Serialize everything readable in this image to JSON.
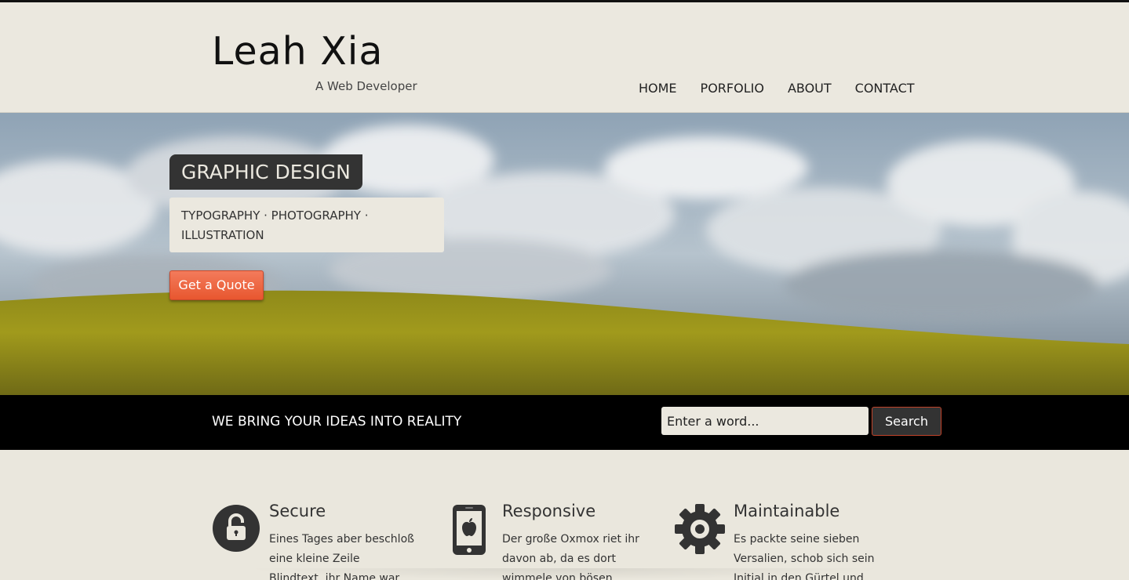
{
  "header": {
    "logo": "Leah Xia",
    "tagline": "A Web Developer",
    "nav": [
      "HOME",
      "PORFOLIO",
      "ABOUT",
      "CONTACT"
    ]
  },
  "hero": {
    "title": "GRAPHIC DESIGN",
    "subtitle_line1": "TYPOGRAPHY · PHOTOGRAPHY ·",
    "subtitle_line2": "ILLUSTRATION",
    "cta": "Get a Quote"
  },
  "bar": {
    "slogan": "WE BRING YOUR IDEAS INTO REALITY",
    "search_placeholder": "Enter a word...",
    "search_button": "Search"
  },
  "features": [
    {
      "title": "Secure",
      "icon": "lock-icon",
      "text": "Eines Tages aber beschloß eine kleine Zeile Blindtext, ihr Name war Lorem"
    },
    {
      "title": "Responsive",
      "icon": "mobile-phone-icon",
      "text": "Der große Oxmox riet ihr davon ab, da es dort wimmele von bösen"
    },
    {
      "title": "Maintainable",
      "icon": "gear-icon",
      "text": "Es packte seine sieben Versalien, schob sich sein Initial in den Gürtel und"
    }
  ],
  "colors": {
    "background": "#eae7dd",
    "dark": "#333333",
    "accent": "#e8572f",
    "bar": "#000000"
  }
}
